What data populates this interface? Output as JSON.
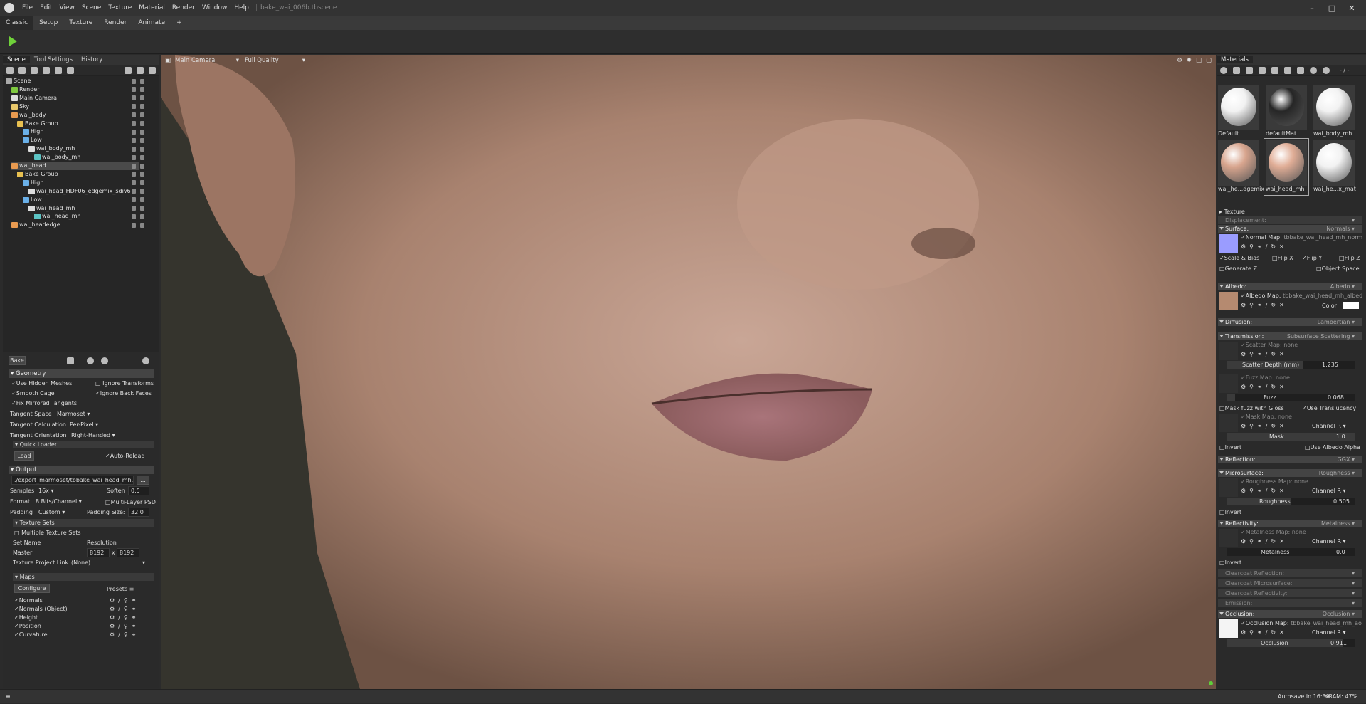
{
  "app": {
    "filename": "bake_wai_006b.tbscene"
  },
  "menu": [
    "File",
    "Edit",
    "View",
    "Scene",
    "Texture",
    "Material",
    "Render",
    "Window",
    "Help"
  ],
  "tabs": [
    "Classic",
    "Setup",
    "Texture",
    "Render",
    "Animate",
    "+"
  ],
  "left": {
    "tabs": [
      "Scene",
      "Tool Settings",
      "History"
    ],
    "tree": [
      {
        "label": "Scene",
        "depth": 0,
        "icon": "scene"
      },
      {
        "label": "Render",
        "depth": 1,
        "icon": "render"
      },
      {
        "label": "Main Camera",
        "depth": 1,
        "icon": "camera"
      },
      {
        "label": "Sky",
        "depth": 1,
        "icon": "sky"
      },
      {
        "label": "wai_body",
        "depth": 1,
        "icon": "object"
      },
      {
        "label": "Bake Group",
        "depth": 2,
        "icon": "folder"
      },
      {
        "label": "High",
        "depth": 3,
        "icon": "mesh"
      },
      {
        "label": "Low",
        "depth": 3,
        "icon": "mesh"
      },
      {
        "label": "wai_body_mh",
        "depth": 4,
        "icon": "file"
      },
      {
        "label": "wai_body_mh",
        "depth": 5,
        "icon": "material"
      },
      {
        "label": "wai_head",
        "depth": 1,
        "icon": "object",
        "selected": true
      },
      {
        "label": "Bake Group",
        "depth": 2,
        "icon": "folder"
      },
      {
        "label": "High",
        "depth": 3,
        "icon": "mesh"
      },
      {
        "label": "wai_head_HDF06_edgemix_sdiv6",
        "depth": 4,
        "icon": "file"
      },
      {
        "label": "Low",
        "depth": 3,
        "icon": "mesh"
      },
      {
        "label": "wai_head_mh",
        "depth": 4,
        "icon": "file"
      },
      {
        "label": "wai_head_mh",
        "depth": 5,
        "icon": "material"
      },
      {
        "label": "wai_headedge",
        "depth": 1,
        "icon": "object"
      }
    ],
    "bake": {
      "title": "Bake",
      "geometry": "Geometry",
      "use_hidden": "Use Hidden Meshes",
      "ignore_transforms": "Ignore Transforms",
      "smooth_cage": "Smooth Cage",
      "ignore_back": "Ignore Back Faces",
      "fix_mirrored": "Fix Mirrored Tangents",
      "tangent_space_label": "Tangent Space",
      "tangent_space": "Marmoset",
      "tangent_calc_label": "Tangent Calculation",
      "tangent_calc": "Per-Pixel",
      "tangent_orient_label": "Tangent Orientation",
      "tangent_orient": "Right-Handed",
      "quick_loader": "Quick Loader",
      "load": "Load",
      "auto_reload": "Auto-Reload",
      "output": "Output",
      "output_path": "./export_marmoset/tbbake_wai_head_mh.pn",
      "browse": "...",
      "samples_label": "Samples",
      "samples": "16x",
      "soften_label": "Soften",
      "soften": "0.5",
      "format_label": "Format",
      "format": "8 Bits/Channel",
      "multilayer": "Multi-Layer PSD",
      "padding_label": "Padding",
      "padding": "Custom",
      "padding_size_label": "Padding Size:",
      "padding_size": "32.0",
      "texture_sets": "Texture Sets",
      "multiple_sets": "Multiple Texture Sets",
      "set_name": "Set Name",
      "resolution": "Resolution",
      "master": "Master",
      "res_w": "8192",
      "res_x": "x",
      "res_h": "8192",
      "project_link_label": "Texture Project Link",
      "project_link": "(None)",
      "maps": "Maps",
      "configure": "Configure",
      "presets": "Presets",
      "map_list": [
        "Normals",
        "Normals (Object)",
        "Height",
        "Position",
        "Curvature"
      ]
    }
  },
  "viewport": {
    "camera": "Main Camera",
    "quality": "Full Quality"
  },
  "right": {
    "title": "Materials",
    "counter": "- / -",
    "materials": [
      {
        "name": "Default",
        "color": "#f2f2f2"
      },
      {
        "name": "defaultMat",
        "color": "#262626"
      },
      {
        "name": "wai_body_mh",
        "color": "#f2f2f2"
      },
      {
        "name": "wai_he...dgemix",
        "color": "#d8a58e"
      },
      {
        "name": "wai_head_mh",
        "color": "#e0ad96"
      },
      {
        "name": "wai_he...x_mat",
        "color": "#f2f2f2"
      }
    ],
    "texture": "Texture",
    "displacement": "Displacement:",
    "surface": "Surface:",
    "surface_mode": "Normals",
    "normal_map": "Normal Map:",
    "normal_file": "tbbake_wai_head_mh_norm",
    "scale_bias": "Scale & Bias",
    "flip_x": "Flip X",
    "flip_y": "Flip Y",
    "flip_z": "Flip Z",
    "gen_z": "Generate Z",
    "object_space": "Object Space",
    "albedo": "Albedo:",
    "albedo_mode": "Albedo",
    "albedo_map": "Albedo Map:",
    "albedo_file": "tbbake_wai_head_mh_albed",
    "color": "Color",
    "diffusion": "Diffusion:",
    "diffusion_mode": "Lambertian",
    "transmission": "Transmission:",
    "transmission_mode": "Subsurface Scattering",
    "scatter_map": "Scatter Map:",
    "none": "none",
    "scatter_depth": "Scatter Depth (mm)",
    "scatter_depth_val": "1.235",
    "fuzz_map": "Fuzz Map:",
    "fuzz": "Fuzz",
    "fuzz_val": "0.068",
    "mask_fuzz": "Mask fuzz with Gloss",
    "use_translucency": "Use Translucency",
    "mask_map": "Mask Map:",
    "channel": "Channel",
    "channel_r": "R",
    "mask": "Mask",
    "mask_val": "1.0",
    "invert": "Invert",
    "use_albedo_alpha": "Use Albedo Alpha",
    "reflection": "Reflection:",
    "reflection_mode": "GGX",
    "microsurface": "Microsurface:",
    "microsurface_mode": "Roughness",
    "roughness_map": "Roughness Map:",
    "roughness": "Roughness",
    "roughness_val": "0.505",
    "reflectivity": "Reflectivity:",
    "reflectivity_mode": "Metalness",
    "metalness_map": "Metalness Map:",
    "metalness": "Metalness",
    "metalness_val": "0.0",
    "clearcoat_reflection": "Clearcoat Reflection:",
    "clearcoat_microsurface": "Clearcoat Microsurface:",
    "clearcoat_reflectivity": "Clearcoat Reflectivity:",
    "emission": "Emission:",
    "occlusion": "Occlusion:",
    "occlusion_mode": "Occlusion",
    "occlusion_map": "Occlusion Map:",
    "occlusion_file": "tbbake_wai_head_mh_ao",
    "occlusion_label": "Occlusion",
    "occlusion_val": "0.911"
  },
  "status": {
    "autosave": "Autosave in 16:39",
    "vram": "VRAM: 47%"
  }
}
